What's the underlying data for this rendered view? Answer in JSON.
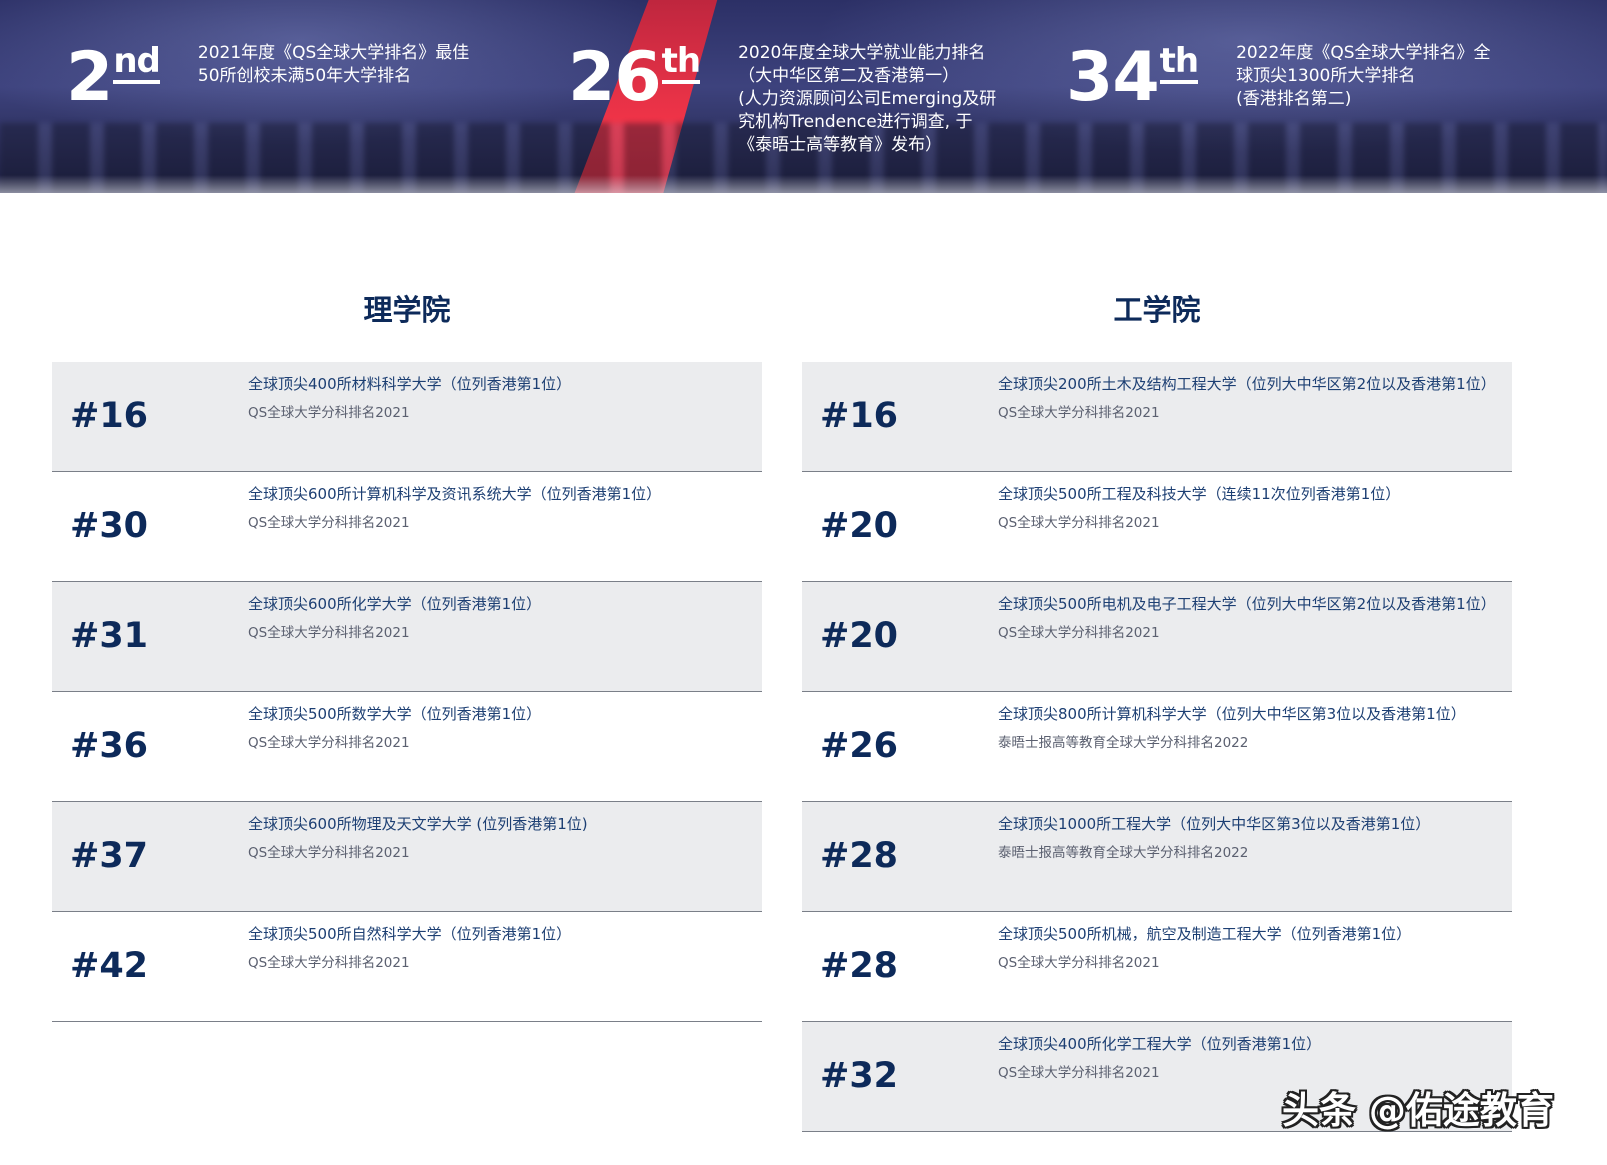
{
  "banner": {
    "stats": [
      {
        "number": "2",
        "suffix": "nd",
        "description": "2021年度《QS全球大学排名》最佳\n50所创校未满50年大学排名"
      },
      {
        "number": "26",
        "suffix": "th",
        "description": "2020年度全球大学就业能力排名\n（大中华区第二及香港第一）\n(人力资源顾问公司Emerging及研\n究机构Trendence进行调查, 于\n《泰晤士高等教育》发布）"
      },
      {
        "number": "34",
        "suffix": "th",
        "description": "2022年度《QS全球大学排名》全\n球顶尖1300所大学排名\n(香港排名第二)"
      }
    ]
  },
  "science": {
    "title": "理学院",
    "rows": [
      {
        "rank": "#16",
        "title": "全球顶尖400所材料科学大学（位列香港第1位）",
        "source": "QS全球大学分科排名2021"
      },
      {
        "rank": "#30",
        "title": "全球顶尖600所计算机科学及资讯系统大学（位列香港第1位）",
        "source": "QS全球大学分科排名2021"
      },
      {
        "rank": "#31",
        "title": "全球顶尖600所化学大学（位列香港第1位）",
        "source": "QS全球大学分科排名2021"
      },
      {
        "rank": "#36",
        "title": "全球顶尖500所数学大学（位列香港第1位）",
        "source": "QS全球大学分科排名2021"
      },
      {
        "rank": "#37",
        "title": "全球顶尖600所物理及天文学大学 (位列香港第1位)",
        "source": "QS全球大学分科排名2021"
      },
      {
        "rank": "#42",
        "title": "全球顶尖500所自然科学大学（位列香港第1位）",
        "source": "QS全球大学分科排名2021"
      }
    ]
  },
  "engineering": {
    "title": "工学院",
    "rows": [
      {
        "rank": "#16",
        "title": "全球顶尖200所土木及结构工程大学（位列大中华区第2位以及香港第1位）",
        "source": "QS全球大学分科排名2021"
      },
      {
        "rank": "#20",
        "title": "全球顶尖500所工程及科技大学（连续11次位列香港第1位）",
        "source": "QS全球大学分科排名2021"
      },
      {
        "rank": "#20",
        "title": "全球顶尖500所电机及电子工程大学（位列大中华区第2位以及香港第1位）",
        "source": "QS全球大学分科排名2021"
      },
      {
        "rank": "#26",
        "title": "全球顶尖800所计算机科学大学（位列大中华区第3位以及香港第1位）",
        "source": "泰晤士报高等教育全球大学分科排名2022"
      },
      {
        "rank": "#28",
        "title": "全球顶尖1000所工程大学（位列大中华区第3位以及香港第1位）",
        "source": "泰晤士报高等教育全球大学分科排名2022"
      },
      {
        "rank": "#28",
        "title": "全球顶尖500所机械，航空及制造工程大学（位列香港第1位）",
        "source": "QS全球大学分科排名2021"
      },
      {
        "rank": "#32",
        "title": "全球顶尖400所化学工程大学（位列香港第1位）",
        "source": "QS全球大学分科排名2021"
      }
    ]
  },
  "watermark": "头条 @佑途教育"
}
